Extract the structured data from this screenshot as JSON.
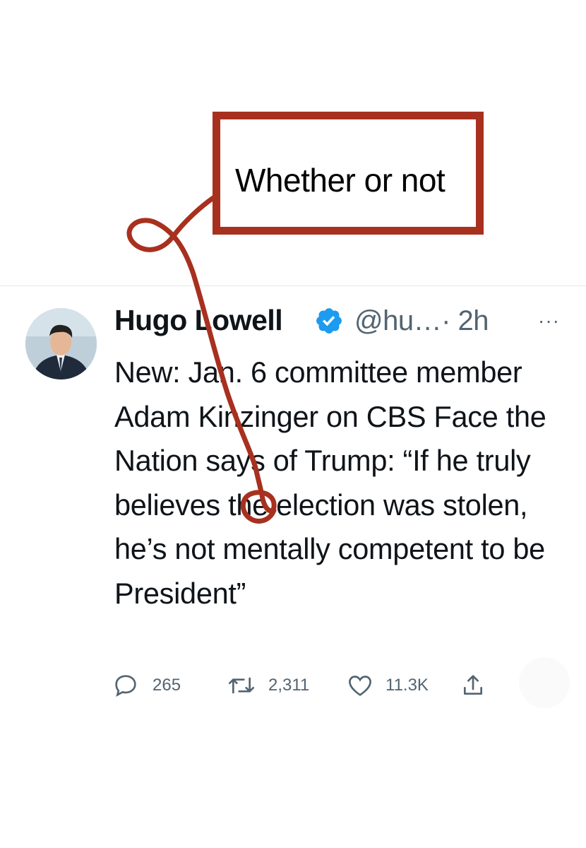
{
  "annotation": {
    "text": "Whether or not"
  },
  "tweet": {
    "author_name": "Hugo Lowell",
    "handle": "@hu…",
    "time": "· 2h",
    "more": "···",
    "body": "New: Jan. 6 committee member Adam Kinzinger on CBS Face the Nation says of Trump: “If he truly believes the election was stolen, he’s not mentally competent to be President”",
    "actions": {
      "replies": "265",
      "retweets": "2,311",
      "likes": "11.3K"
    }
  },
  "icons": [
    "verified-badge-icon",
    "reply-icon",
    "retweet-icon",
    "like-icon",
    "share-icon",
    "more-icon"
  ],
  "colors": {
    "annotation_red": "#a8301f",
    "twitter_blue": "#1d9bf0",
    "muted": "#536471"
  }
}
